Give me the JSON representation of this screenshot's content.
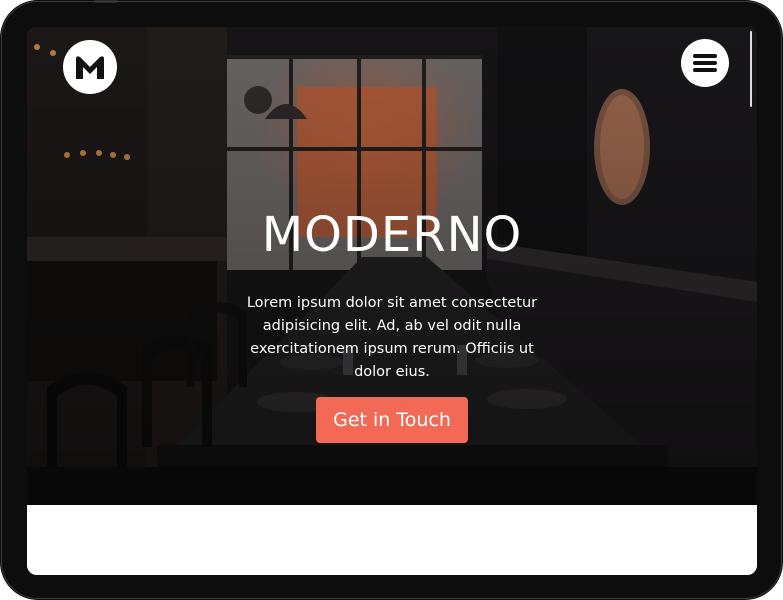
{
  "brand": {
    "logo_icon": "m-logo-icon",
    "title": "MODERNO"
  },
  "nav": {
    "menu_icon": "hamburger-menu-icon"
  },
  "hero": {
    "description": "Lorem ipsum dolor sit amet consectetur adipisicing elit. Ad, ab vel odit nulla exercitationem ipsum rerum. Officiis ut dolor eius.",
    "cta_label": "Get in Touch",
    "background_image": "restaurant-interior-photo"
  },
  "colors": {
    "accent": "#f26a55",
    "text": "#ffffff",
    "device_frame": "#0d0d0d"
  }
}
